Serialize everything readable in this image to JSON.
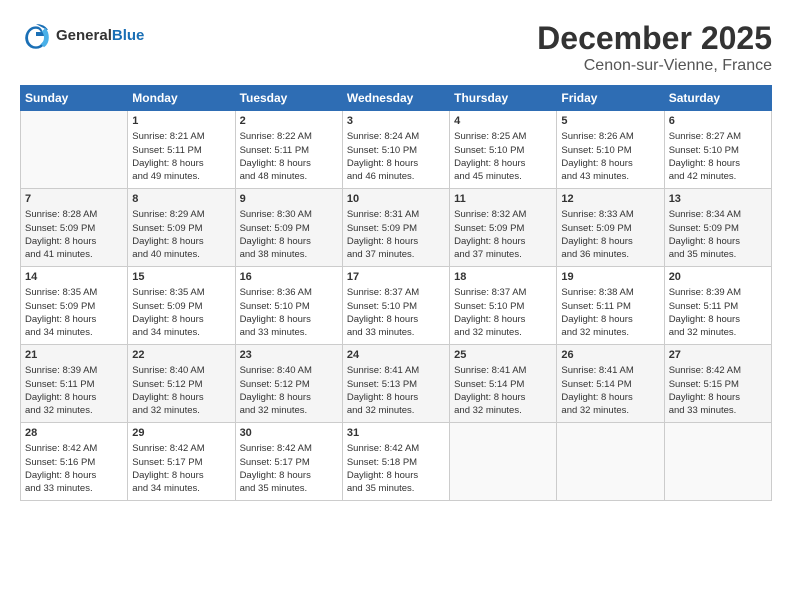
{
  "header": {
    "logo_line1": "General",
    "logo_line2": "Blue",
    "main_title": "December 2025",
    "subtitle": "Cenon-sur-Vienne, France"
  },
  "calendar": {
    "headers": [
      "Sunday",
      "Monday",
      "Tuesday",
      "Wednesday",
      "Thursday",
      "Friday",
      "Saturday"
    ],
    "weeks": [
      [
        {
          "day": "",
          "content": ""
        },
        {
          "day": "1",
          "content": "Sunrise: 8:21 AM\nSunset: 5:11 PM\nDaylight: 8 hours\nand 49 minutes."
        },
        {
          "day": "2",
          "content": "Sunrise: 8:22 AM\nSunset: 5:11 PM\nDaylight: 8 hours\nand 48 minutes."
        },
        {
          "day": "3",
          "content": "Sunrise: 8:24 AM\nSunset: 5:10 PM\nDaylight: 8 hours\nand 46 minutes."
        },
        {
          "day": "4",
          "content": "Sunrise: 8:25 AM\nSunset: 5:10 PM\nDaylight: 8 hours\nand 45 minutes."
        },
        {
          "day": "5",
          "content": "Sunrise: 8:26 AM\nSunset: 5:10 PM\nDaylight: 8 hours\nand 43 minutes."
        },
        {
          "day": "6",
          "content": "Sunrise: 8:27 AM\nSunset: 5:10 PM\nDaylight: 8 hours\nand 42 minutes."
        }
      ],
      [
        {
          "day": "7",
          "content": "Sunrise: 8:28 AM\nSunset: 5:09 PM\nDaylight: 8 hours\nand 41 minutes."
        },
        {
          "day": "8",
          "content": "Sunrise: 8:29 AM\nSunset: 5:09 PM\nDaylight: 8 hours\nand 40 minutes."
        },
        {
          "day": "9",
          "content": "Sunrise: 8:30 AM\nSunset: 5:09 PM\nDaylight: 8 hours\nand 38 minutes."
        },
        {
          "day": "10",
          "content": "Sunrise: 8:31 AM\nSunset: 5:09 PM\nDaylight: 8 hours\nand 37 minutes."
        },
        {
          "day": "11",
          "content": "Sunrise: 8:32 AM\nSunset: 5:09 PM\nDaylight: 8 hours\nand 37 minutes."
        },
        {
          "day": "12",
          "content": "Sunrise: 8:33 AM\nSunset: 5:09 PM\nDaylight: 8 hours\nand 36 minutes."
        },
        {
          "day": "13",
          "content": "Sunrise: 8:34 AM\nSunset: 5:09 PM\nDaylight: 8 hours\nand 35 minutes."
        }
      ],
      [
        {
          "day": "14",
          "content": "Sunrise: 8:35 AM\nSunset: 5:09 PM\nDaylight: 8 hours\nand 34 minutes."
        },
        {
          "day": "15",
          "content": "Sunrise: 8:35 AM\nSunset: 5:09 PM\nDaylight: 8 hours\nand 34 minutes."
        },
        {
          "day": "16",
          "content": "Sunrise: 8:36 AM\nSunset: 5:10 PM\nDaylight: 8 hours\nand 33 minutes."
        },
        {
          "day": "17",
          "content": "Sunrise: 8:37 AM\nSunset: 5:10 PM\nDaylight: 8 hours\nand 33 minutes."
        },
        {
          "day": "18",
          "content": "Sunrise: 8:37 AM\nSunset: 5:10 PM\nDaylight: 8 hours\nand 32 minutes."
        },
        {
          "day": "19",
          "content": "Sunrise: 8:38 AM\nSunset: 5:11 PM\nDaylight: 8 hours\nand 32 minutes."
        },
        {
          "day": "20",
          "content": "Sunrise: 8:39 AM\nSunset: 5:11 PM\nDaylight: 8 hours\nand 32 minutes."
        }
      ],
      [
        {
          "day": "21",
          "content": "Sunrise: 8:39 AM\nSunset: 5:11 PM\nDaylight: 8 hours\nand 32 minutes."
        },
        {
          "day": "22",
          "content": "Sunrise: 8:40 AM\nSunset: 5:12 PM\nDaylight: 8 hours\nand 32 minutes."
        },
        {
          "day": "23",
          "content": "Sunrise: 8:40 AM\nSunset: 5:12 PM\nDaylight: 8 hours\nand 32 minutes."
        },
        {
          "day": "24",
          "content": "Sunrise: 8:41 AM\nSunset: 5:13 PM\nDaylight: 8 hours\nand 32 minutes."
        },
        {
          "day": "25",
          "content": "Sunrise: 8:41 AM\nSunset: 5:14 PM\nDaylight: 8 hours\nand 32 minutes."
        },
        {
          "day": "26",
          "content": "Sunrise: 8:41 AM\nSunset: 5:14 PM\nDaylight: 8 hours\nand 32 minutes."
        },
        {
          "day": "27",
          "content": "Sunrise: 8:42 AM\nSunset: 5:15 PM\nDaylight: 8 hours\nand 33 minutes."
        }
      ],
      [
        {
          "day": "28",
          "content": "Sunrise: 8:42 AM\nSunset: 5:16 PM\nDaylight: 8 hours\nand 33 minutes."
        },
        {
          "day": "29",
          "content": "Sunrise: 8:42 AM\nSunset: 5:17 PM\nDaylight: 8 hours\nand 34 minutes."
        },
        {
          "day": "30",
          "content": "Sunrise: 8:42 AM\nSunset: 5:17 PM\nDaylight: 8 hours\nand 35 minutes."
        },
        {
          "day": "31",
          "content": "Sunrise: 8:42 AM\nSunset: 5:18 PM\nDaylight: 8 hours\nand 35 minutes."
        },
        {
          "day": "",
          "content": ""
        },
        {
          "day": "",
          "content": ""
        },
        {
          "day": "",
          "content": ""
        }
      ]
    ]
  }
}
